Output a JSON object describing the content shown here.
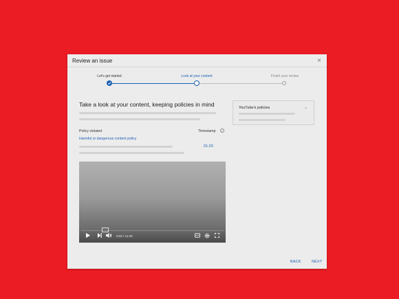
{
  "dialog": {
    "title": "Review an issue",
    "close_icon": "×"
  },
  "stepper": {
    "steps": [
      {
        "label": "Let's get started",
        "state": "completed"
      },
      {
        "label": "Look at your content",
        "state": "current"
      },
      {
        "label": "Finish your review",
        "state": "upcoming"
      }
    ]
  },
  "main": {
    "heading": "Take a look at your content, keeping policies in mind",
    "policy_violated_label": "Policy violated",
    "policy_link": "Harmful or dangerous content policy",
    "timestamp_label": "Timestamp",
    "timestamp_value": "01:20"
  },
  "side_panel": {
    "title": "YouTube's policies",
    "chevron": "⌄"
  },
  "video": {
    "time_text": "0:00 / 12:32"
  },
  "footer": {
    "back_label": "BACK",
    "next_label": "NEXT"
  },
  "colors": {
    "background": "#ec1c24",
    "accent": "#1a5fb4"
  }
}
